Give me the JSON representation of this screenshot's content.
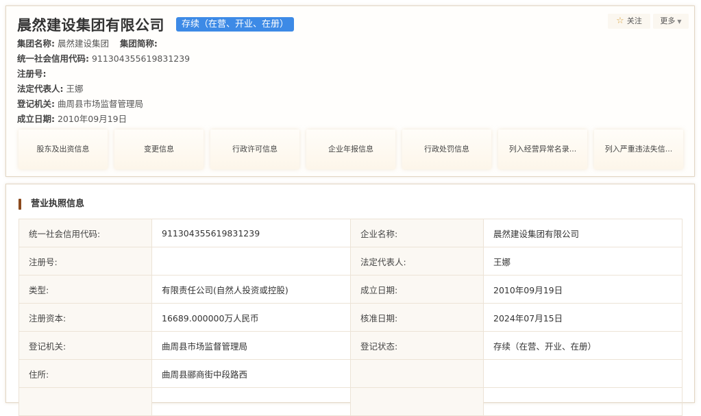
{
  "company": {
    "name": "晨然建设集团有限公司",
    "status": "存续（在营、开业、在册）",
    "follow_label": "关注",
    "more_label": "更多"
  },
  "summary": {
    "group_name_label": "集团名称:",
    "group_name": "晨然建设集团",
    "group_abbr_label": "集团简称:",
    "credit_code_label": "统一社会信用代码:",
    "credit_code": "911304355619831239",
    "reg_no_label": "注册号:",
    "legal_rep_label": "法定代表人:",
    "legal_rep": "王娜",
    "authority_label": "登记机关:",
    "authority": "曲周县市场监督管理局",
    "founded_label": "成立日期:",
    "founded": "2010年09月19日"
  },
  "quick_links": [
    "股东及出资信息",
    "变更信息",
    "行政许可信息",
    "企业年报信息",
    "行政处罚信息",
    "列入经营异常名录...",
    "列入严重违法失信..."
  ],
  "license": {
    "title": "营业执照信息",
    "rows": [
      {
        "k1": "统一社会信用代码:",
        "v1": "911304355619831239",
        "k2": "企业名称:",
        "v2": "晨然建设集团有限公司"
      },
      {
        "k1": "注册号:",
        "v1": "",
        "k2": "法定代表人:",
        "v2": "王娜"
      },
      {
        "k1": "类型:",
        "v1": "有限责任公司(自然人投资或控股)",
        "k2": "成立日期:",
        "v2": "2010年09月19日"
      },
      {
        "k1": "注册资本:",
        "v1": "16689.000000万人民币",
        "k2": "核准日期:",
        "v2": "2024年07月15日"
      },
      {
        "k1": "登记机关:",
        "v1": "曲周县市场监督管理局",
        "k2": "登记状态:",
        "v2": "存续（在营、开业、在册）"
      },
      {
        "k1": "住所:",
        "v1": "曲周县郦商街中段路西",
        "k2": "",
        "v2": ""
      },
      {
        "k1": "",
        "v1": "",
        "k2": "",
        "v2": ""
      }
    ]
  }
}
